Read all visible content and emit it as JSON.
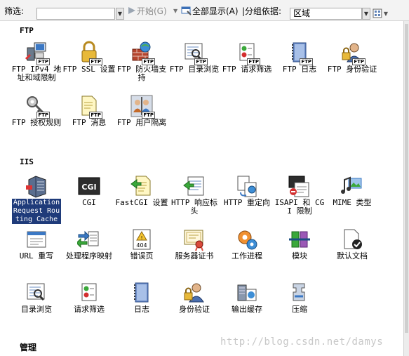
{
  "toolbar": {
    "filter_label": "筛选:",
    "start_label": "开始(G)",
    "show_all_label": "全部显示(A)",
    "group_label": "|分组依据:",
    "group_value": "区域"
  },
  "sections": {
    "ftp": "FTP",
    "iis": "IIS",
    "manage": "管理"
  },
  "ftp_items": [
    {
      "label": "FTP IPv4 地址和域限制",
      "icon": "network-computer-icon"
    },
    {
      "label": "FTP SSL 设置",
      "icon": "lock-icon"
    },
    {
      "label": "FTP 防火墙支持",
      "icon": "firewall-icon"
    },
    {
      "label": "FTP 目录浏览",
      "icon": "directory-browse-icon"
    },
    {
      "label": "FTP 请求筛选",
      "icon": "request-filter-icon"
    },
    {
      "label": "FTP 日志",
      "icon": "log-book-icon"
    },
    {
      "label": "FTP 身份验证",
      "icon": "user-lock-icon"
    },
    {
      "label": "FTP 授权规则",
      "icon": "key-icon"
    },
    {
      "label": "FTP 消息",
      "icon": "message-document-icon"
    },
    {
      "label": "FTP 用户隔离",
      "icon": "user-isolation-icon"
    }
  ],
  "iis_items": [
    {
      "label": "Application Request Routing Cache",
      "icon": "server-icon"
    },
    {
      "label": "CGI",
      "icon": "cgi-icon"
    },
    {
      "label": "FastCGI 设置",
      "icon": "fastcgi-icon"
    },
    {
      "label": "HTTP 响应标头",
      "icon": "response-header-icon"
    },
    {
      "label": "HTTP 重定向",
      "icon": "redirect-icon"
    },
    {
      "label": "ISAPI 和 CGI 限制",
      "icon": "isapi-icon"
    },
    {
      "label": "MIME 类型",
      "icon": "mime-icon"
    },
    {
      "label": "URL 重写",
      "icon": "url-rewrite-icon"
    },
    {
      "label": "处理程序映射",
      "icon": "handler-mapping-icon"
    },
    {
      "label": "错误页",
      "icon": "error-page-icon"
    },
    {
      "label": "服务器证书",
      "icon": "certificate-icon"
    },
    {
      "label": "工作进程",
      "icon": "worker-process-icon"
    },
    {
      "label": "模块",
      "icon": "modules-icon"
    },
    {
      "label": "默认文档",
      "icon": "default-document-icon"
    },
    {
      "label": "目录浏览",
      "icon": "directory-browse-icon"
    },
    {
      "label": "请求筛选",
      "icon": "request-filter-icon"
    },
    {
      "label": "日志",
      "icon": "log-book-icon"
    },
    {
      "label": "身份验证",
      "icon": "user-lock-icon"
    },
    {
      "label": "输出缓存",
      "icon": "output-cache-icon"
    },
    {
      "label": "压缩",
      "icon": "compression-icon"
    }
  ],
  "badge": "FTP",
  "cgi_text": "CGI",
  "error_code": "404",
  "watermark": "http://blog.csdn.net/damys"
}
